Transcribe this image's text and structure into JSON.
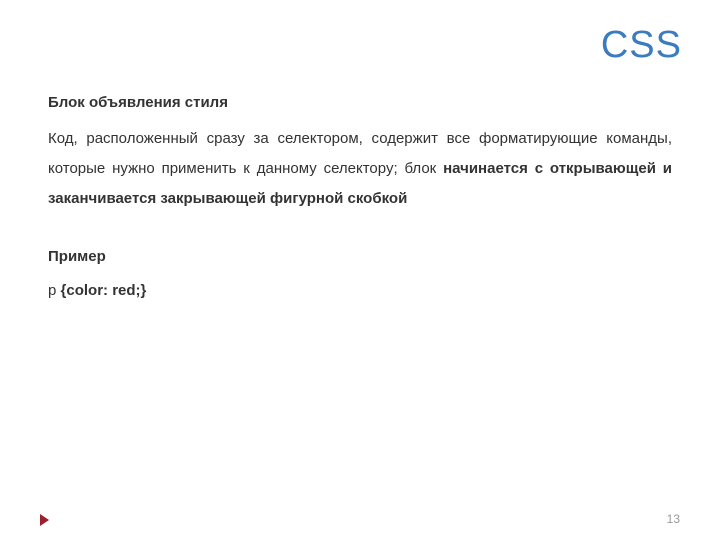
{
  "title": "CSS",
  "heading": "Блок объявления стиля",
  "paragraph_lead": "Код, расположенный сразу за селектором, содержит все форматирующие команды, которые нужно применить к данному селектору; блок ",
  "paragraph_bold": "начинается с открывающей и заканчивается закрывающей фигурной скобкой",
  "example_label": "Пример",
  "example_prefix": "p ",
  "example_code": "{color: red;}",
  "page_number": "13"
}
